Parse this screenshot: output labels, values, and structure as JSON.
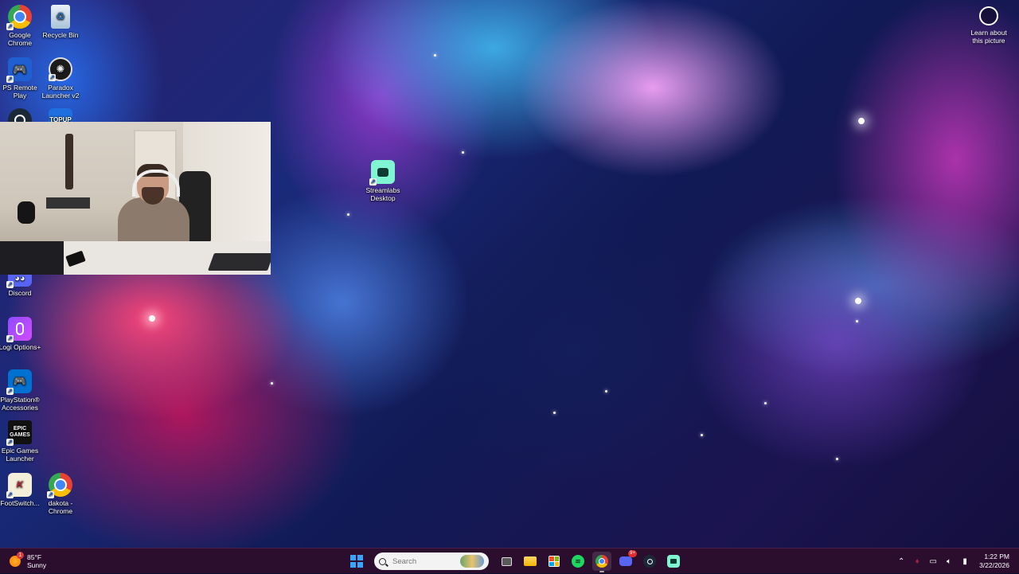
{
  "desktop": {
    "icons": [
      {
        "label": "Google Chrome",
        "icon": "chrome-icon"
      },
      {
        "label": "Recycle Bin",
        "icon": "recycle-bin-icon"
      },
      {
        "label": "PS Remote Play",
        "icon": "ps-remote-play-icon"
      },
      {
        "label": "Paradox Launcher v2",
        "icon": "paradox-launcher-icon"
      },
      {
        "label": "",
        "icon": "steam-icon"
      },
      {
        "label": "TOPUP",
        "icon": "topup-icon"
      },
      {
        "label": "Streamlabs Desktop",
        "icon": "streamlabs-icon"
      },
      {
        "label": "Discord",
        "icon": "discord-icon"
      },
      {
        "label": "Logi Options+",
        "icon": "logi-options-icon"
      },
      {
        "label": "PlayStation® Accessories",
        "icon": "playstation-accessories-icon"
      },
      {
        "label": "Epic Games Launcher",
        "icon": "epic-games-icon"
      },
      {
        "label": "FootSwitch...",
        "icon": "footswitch-icon"
      },
      {
        "label": "dakota - Chrome",
        "icon": "chrome-profile-icon"
      }
    ],
    "epic_logo_text": "EPIC GAMES",
    "learn_picture": "Learn about this picture"
  },
  "taskbar": {
    "weather": {
      "temp": "85°F",
      "condition": "Sunny",
      "badge": "1"
    },
    "search_placeholder": "Search",
    "apps": [
      {
        "name": "start",
        "icon": "windows-icon"
      },
      {
        "name": "task-view",
        "icon": "task-view-icon"
      },
      {
        "name": "file-explorer",
        "icon": "folder-icon"
      },
      {
        "name": "microsoft-store",
        "icon": "store-icon"
      },
      {
        "name": "spotify",
        "icon": "spotify-icon"
      },
      {
        "name": "chrome",
        "icon": "chrome-icon"
      },
      {
        "name": "discord",
        "icon": "discord-icon",
        "badge": "9+"
      },
      {
        "name": "steam",
        "icon": "steam-icon"
      },
      {
        "name": "streamlabs",
        "icon": "streamlabs-icon"
      }
    ],
    "clock": {
      "time": "1:22 PM",
      "date": "3/22/2026"
    }
  },
  "colors": {
    "taskbar_bg": "#2b0d2e",
    "streamlabs_green": "#80f5d2",
    "windows_blue": "#3aa5ff"
  }
}
